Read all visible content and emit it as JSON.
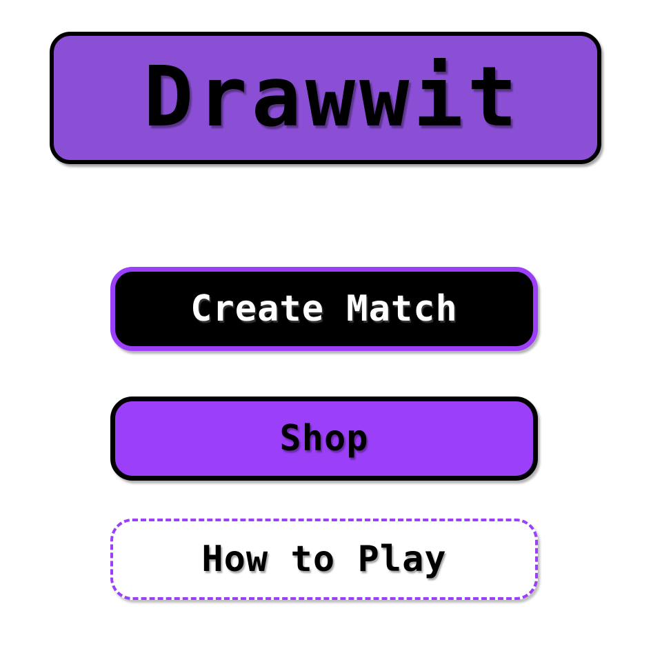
{
  "title": {
    "text": "Drawwit"
  },
  "menu": {
    "create_match": "Create Match",
    "shop": "Shop",
    "how_to_play": "How to Play"
  },
  "colors": {
    "purple_banner": "#8b4fd6",
    "purple_button": "#9b3ff8",
    "black": "#000000",
    "white": "#ffffff"
  }
}
